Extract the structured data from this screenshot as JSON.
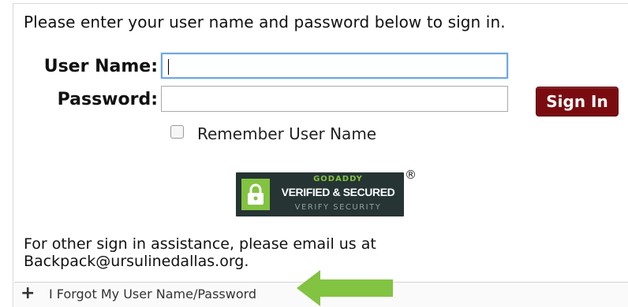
{
  "intro_text": "Please enter your user name and password below to sign in.",
  "form": {
    "username_label": "User Name:",
    "username_value": "",
    "password_label": "Password:",
    "password_value": "",
    "sign_in_label": "Sign In",
    "remember_label": "Remember User Name",
    "remember_checked": false
  },
  "badge": {
    "brand": "GODADDY",
    "title": "VERIFIED & SECURED",
    "subtitle": "VERIFY SECURITY",
    "registered_mark": "®",
    "icon": "lock-icon"
  },
  "assistance": {
    "line1": "For other sign in assistance, please email us at",
    "line2": "Backpack@ursulinedallas.org."
  },
  "footer": {
    "expand_glyph": "+",
    "forgot_link": "I Forgot My User Name/Password"
  },
  "colors": {
    "sign_in_button": "#7a0c10",
    "badge_background": "#263434",
    "badge_accent": "#82c341",
    "arrow": "#82c341",
    "focus_border": "#6fa8e0"
  }
}
